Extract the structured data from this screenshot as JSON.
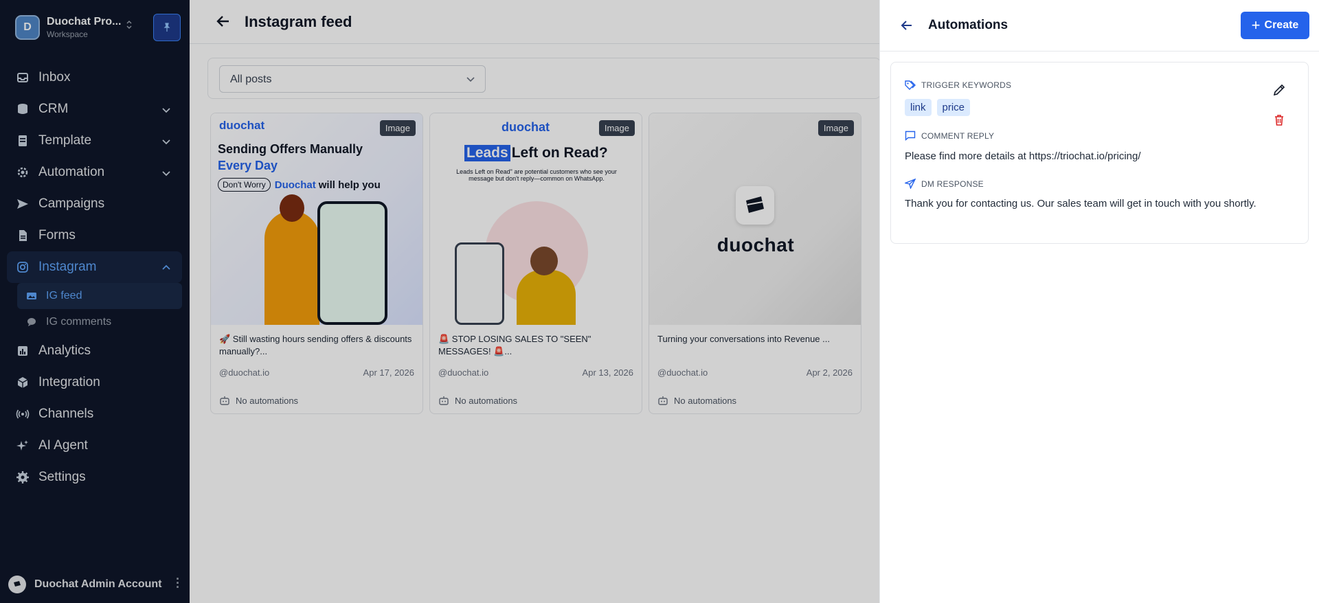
{
  "sidebar": {
    "workspace_initial": "D",
    "workspace_name": "Duochat Pro...",
    "workspace_sub": "Workspace",
    "items": [
      {
        "label": "Inbox"
      },
      {
        "label": "CRM"
      },
      {
        "label": "Template"
      },
      {
        "label": "Automation"
      },
      {
        "label": "Campaigns"
      },
      {
        "label": "Forms"
      },
      {
        "label": "Instagram"
      },
      {
        "label": "Analytics"
      },
      {
        "label": "Integration"
      },
      {
        "label": "Channels"
      },
      {
        "label": "AI Agent"
      },
      {
        "label": "Settings"
      }
    ],
    "sub_items": [
      {
        "label": "IG feed"
      },
      {
        "label": "IG comments"
      }
    ],
    "account_name": "Duochat Admin Account"
  },
  "main": {
    "title": "Instagram feed",
    "filter_value": "All posts",
    "posts": [
      {
        "badge": "Image",
        "caption": "🚀 Still wasting hours sending offers & discounts manually?...",
        "handle": "@duochat.io",
        "date": "Apr 17, 2026",
        "automations": "No automations",
        "art_line1": "Sending Offers Manually",
        "art_line2": "Every Day",
        "art_chip": "Don't Worry",
        "art_brand": "Duochat",
        "art_tail": "will help you"
      },
      {
        "badge": "Image",
        "caption": "🚨 STOP LOSING SALES TO \"SEEN\" MESSAGES! 🚨...",
        "handle": "@duochat.io",
        "date": "Apr 13, 2026",
        "automations": "No automations",
        "art_hl": "Leads",
        "art_title": "Left on Read?",
        "art_sub": "Leads Left on Read\" are potential customers who see your message but don't reply—common on WhatsApp."
      },
      {
        "badge": "Image",
        "caption": "Turning your conversations into Revenue ...",
        "handle": "@duochat.io",
        "date": "Apr 2, 2026",
        "automations": "No automations",
        "art_word": "duochat"
      }
    ],
    "logo_text": "duochat"
  },
  "panel": {
    "title": "Automations",
    "create_label": "Create",
    "trigger_label": "TRIGGER KEYWORDS",
    "keywords": [
      "link",
      "price"
    ],
    "comment_label": "COMMENT REPLY",
    "comment_text": "Please find more details at https://triochat.io/pricing/",
    "dm_label": "DM RESPONSE",
    "dm_text": "Thank you for contacting us. Our sales team will get in touch with you shortly."
  },
  "colors": {
    "sidebar_bg": "#0f172a",
    "accent": "#2563eb",
    "active_text": "#60a5fa"
  }
}
